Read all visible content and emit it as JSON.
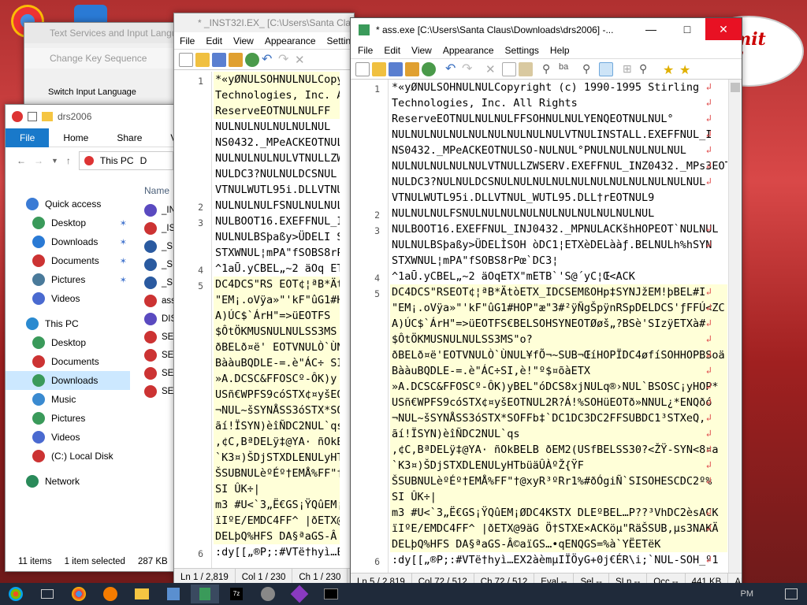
{
  "desktop": {
    "greeting_fragment": "mit\nv"
  },
  "text_services_window": {
    "title": "Text Services and Input Langua",
    "sub_title": "Change Key Sequence",
    "body_label": "Switch Input Language"
  },
  "explorer": {
    "title": "drs2006",
    "ribbon_tabs": [
      "File",
      "Home",
      "Share",
      "View"
    ],
    "breadcrumb_root": "This PC",
    "breadcrumb_next": "D",
    "column_header": "Name",
    "nav": [
      {
        "label": "Quick access",
        "level": 0
      },
      {
        "label": "Desktop",
        "level": 1,
        "pinned": true
      },
      {
        "label": "Downloads",
        "level": 1,
        "pinned": true
      },
      {
        "label": "Documents",
        "level": 1,
        "pinned": true
      },
      {
        "label": "Pictures",
        "level": 1,
        "pinned": true
      },
      {
        "label": "Videos",
        "level": 1,
        "pinned": false
      },
      {
        "label": "This PC",
        "level": 0
      },
      {
        "label": "Desktop",
        "level": 1
      },
      {
        "label": "Documents",
        "level": 1
      },
      {
        "label": "Downloads",
        "level": 1,
        "selected": true
      },
      {
        "label": "Music",
        "level": 1
      },
      {
        "label": "Pictures",
        "level": 1
      },
      {
        "label": "Videos",
        "level": 1
      },
      {
        "label": "(C:) Local Disk",
        "level": 1
      },
      {
        "label": "Network",
        "level": 0
      }
    ],
    "files": [
      "_IN",
      "_IS",
      "_SE",
      "_SE",
      "_SE",
      "ass",
      "DIS",
      "SET",
      "SET",
      "SET",
      "SET"
    ],
    "status_items": "11 items",
    "status_selected": "1 item selected",
    "status_size": "287 KB"
  },
  "notepad_back": {
    "title": "* _INST32I.EX_ [C:\\Users\\Santa Claus\\",
    "menu": [
      "File",
      "Edit",
      "View",
      "Appearance",
      "Settin"
    ],
    "lines": [
      {
        "n": "1",
        "t": "*«yØNULSOHNULNULCopyr",
        "hl": true
      },
      {
        "n": "",
        "t": "Technologies, Inc. All",
        "hl": true
      },
      {
        "n": "",
        "t": "ReserveEOTNULNULFF",
        "hl": true
      },
      {
        "n": "",
        "t": "NULNULNULNULNULNUL",
        "hl": false
      },
      {
        "n": "",
        "t": "NS0432._MPeACKEOTNUL",
        "hl": false
      },
      {
        "n": "",
        "t": "NULNULNULNULVTNULLZWS",
        "hl": false
      },
      {
        "n": "",
        "t": "NULDC3?NULNULDCSNUL",
        "hl": false
      },
      {
        "n": "",
        "t": "VTNULWUTL95i.DLLVTNUL",
        "hl": false
      },
      {
        "n": "2",
        "t": "NULNULNULFSNULNULNUL",
        "hl": false
      },
      {
        "n": "3",
        "t": "NULBOOT16.EXEFFNUL_IN",
        "hl": false
      },
      {
        "n": "",
        "t": "NULNULBSþaßy>ÜDELI SOH",
        "hl": false
      },
      {
        "n": "",
        "t": "STXWNUL¦mPA\"fSOBS8rP",
        "hl": false
      },
      {
        "n": "4",
        "t": "^1aŪ.yCBEL„~2 äOq ETX",
        "hl": false
      },
      {
        "n": "5",
        "t": "DC4DCS\"RS EOT¢¦ªB*Ätt",
        "hl": true
      },
      {
        "n": "",
        "t": "\"EM¡.oVÿa»\"'kF\"ûG1#HOP",
        "hl": true
      },
      {
        "n": "",
        "t": "A)ÚC$`ÁrH\"=>üEOTFS",
        "hl": true
      },
      {
        "n": "",
        "t": "$ÔtÖKMUSNULNULSS3MS",
        "hl": true
      },
      {
        "n": "",
        "t": "ðBELð¤ë' EOTVNULÒ`ÙNUL",
        "hl": true
      },
      {
        "n": "",
        "t": "BààuBQDLE-=.è\"ÁC÷ SI,è",
        "hl": true
      },
      {
        "n": "",
        "t": "»A.DCSC&FFOSCº-ÔK)y",
        "hl": true
      },
      {
        "n": "",
        "t": "USñ€WPFS9cóSTX¢¤yšEO",
        "hl": true
      },
      {
        "n": "",
        "t": "¬NUL~šSYNÅSS3óSTX*SO",
        "hl": true
      },
      {
        "n": "",
        "t": "ãí!ÏSYN)èîÑDC2NUL`qs",
        "hl": true
      },
      {
        "n": "",
        "t": ",¢C,BªDELÿ‡@YA· ñOkBE",
        "hl": true
      },
      {
        "n": "",
        "t": "`K3¤)ŠDjSTXDLENULyHTb",
        "hl": true
      },
      {
        "n": "",
        "t": "ŠSUBNULèºÉº†EMÅ%FF\"†@",
        "hl": true
      },
      {
        "n": "",
        "t": "SI ÛK÷|",
        "hl": true
      },
      {
        "n": "",
        "t": "m3  #U<`3„Ë€GS¡ŸQûEM¡",
        "hl": true
      },
      {
        "n": "",
        "t": "ïIºE/EMDC4FF^ |ðETX@",
        "hl": true
      },
      {
        "n": "",
        "t": "DELþQ%HFS DA§ªaGS-Â",
        "hl": true
      },
      {
        "n": "6",
        "t": ":dy[[„®P;:#VTë†hyì…EX",
        "hl": false
      }
    ],
    "status": [
      "Ln 1 / 2,819",
      "Col 1 / 230",
      "Ch 1 / 230",
      "Ev"
    ]
  },
  "notepad_front": {
    "title": "* ass.exe [C:\\Users\\Santa Claus\\Downloads\\drs2006] -...",
    "menu": [
      "File",
      "Edit",
      "View",
      "Appearance",
      "Settings",
      "Help"
    ],
    "lines": [
      {
        "n": "1",
        "t": "*«yØNULSOHNULNULCopyright (c) 1990-1995 Stirling",
        "hl": false,
        "wrap": true
      },
      {
        "n": "",
        "t": "Technologies, Inc. All Rights",
        "hl": false,
        "wrap": true
      },
      {
        "n": "",
        "t": "ReserveEOTNULNULNULFFSOHNULNULYENQEOTNULNUL°",
        "hl": false,
        "wrap": true
      },
      {
        "n": "",
        "t": "NULNULNULNULNULNULNULNULNULVTNULINSTALL.EXEFFNUL_I",
        "hl": false,
        "wrap": true
      },
      {
        "n": "",
        "t": "NS0432._MPeACKEOTNULSO-NULNUL°PNULNULNULNULNUL",
        "hl": false,
        "wrap": true
      },
      {
        "n": "",
        "t": "NULNULNULNULNULVTNULLZWSERV.EXEFFNUL_INZ0432._MPs3EOT",
        "hl": false,
        "wrap": true
      },
      {
        "n": "",
        "t": "NULDC3?NULNULDCSNULNULNULNULNULNULNULNULNULNULNUL",
        "hl": false,
        "wrap": true
      },
      {
        "n": "",
        "t": "VTNULWUTL95i.DLLVTNUL_WUTL95.DLL†rEOTNUL9",
        "hl": false,
        "wrap": false
      },
      {
        "n": "2",
        "t": "NULNULNULFSNULNULNULNULNULNULNULNULNULNUL",
        "hl": false,
        "wrap": false
      },
      {
        "n": "3",
        "t": "NULBOOT16.EXEFFNUL_INJ0432._MPNULACKšhHOPEOT`NULNUL",
        "hl": false,
        "wrap": true
      },
      {
        "n": "",
        "t": "NULNULBSþaßy>ÜDELÌSOH òDC1¦ETXèDELààƒ.BELNULh%hSYN",
        "hl": false,
        "wrap": true
      },
      {
        "n": "",
        "t": "STXWNUL¦mPA\"fSOBS8rPœ`DC3¦",
        "hl": false,
        "wrap": false
      },
      {
        "n": "4",
        "t": "^1aŪ.yCBEL„~2 äOqETX\"mETB`'S@´yC¦Œ<ACK",
        "hl": false,
        "wrap": false
      },
      {
        "n": "5",
        "t": "DC4DCS\"RSEOT¢¦ªB*ÄtòETX_IDCSEMßOHp‡SYNJžEM!þBEL#I",
        "hl": true,
        "wrap": true
      },
      {
        "n": "",
        "t": "\"EM¡.oVÿa»\"'kF\"ûG1#HOP\"æ\"3#²ÿÑgŠpÿnRSpDELDCS'ƒFFÚ<ZC",
        "hl": true,
        "wrap": true
      },
      {
        "n": "",
        "t": "A)ÚC$`ÁrH\"=>üEOTFS€BELSOHSYNEOTØøš„?BSè'SIzÿETXà#",
        "hl": true,
        "wrap": true
      },
      {
        "n": "",
        "t": "$ÔtÖKMUSNULNULSS3MS\"o?",
        "hl": true,
        "wrap": true
      },
      {
        "n": "",
        "t": "ðBELð¤ë'EOTVNULÒ`ÙNUL¥fÕ¬~SUB¬ŒíHOPÏDC4øfíSOHHOPBSoä",
        "hl": true,
        "wrap": true
      },
      {
        "n": "",
        "t": "BààuBQDLE-=.è\"ÁC÷SI,è!\"º$¤õàETX",
        "hl": true,
        "wrap": true
      },
      {
        "n": "",
        "t": "»A.DCSC&FFOSCº-ÔK)yBEL\"óDCS8xjNULq®›NUL`BSOSC¡yHOP*",
        "hl": true,
        "wrap": true
      },
      {
        "n": "",
        "t": "USñ€WPFS9cóSTX¢¤yšEOTNUL2R?Á!%SOHüEOTð»NNUL¿*ENQðó",
        "hl": true,
        "wrap": true
      },
      {
        "n": "",
        "t": "¬NUL~šSYNÅSS3óSTX*SOFFb‡`DC1DC3DC2FFSUBDC1³STXeQ,",
        "hl": true,
        "wrap": true
      },
      {
        "n": "",
        "t": "ãí!ÏSYN)èîÑDC2NUL`qs",
        "hl": true,
        "wrap": true
      },
      {
        "n": "",
        "t": ",¢C,BªDELÿ‡@YA· ñOkBELB ðEM2(USfBELSS30?<ŽŸ-SYN<8¤a",
        "hl": true,
        "wrap": true
      },
      {
        "n": "",
        "t": "`K3¤)ŠDjSTXDLENULyHTbüäÛÀºŽ{ŸF",
        "hl": true,
        "wrap": true
      },
      {
        "n": "",
        "t": "ŠSUBNULèºÉº†EMÅ%FF\"†@xyR³ºRr1%#ðÓgiÑ`SISOHESCDC2º%",
        "hl": true,
        "wrap": true
      },
      {
        "n": "",
        "t": "SI ÛK÷|",
        "hl": true,
        "wrap": false
      },
      {
        "n": "",
        "t": "m3  #U<`3„Ë€GS¡ŸQûEM¡ØDC4KSTX DLEºBEL…P??³VhDC2èsACK",
        "hl": true,
        "wrap": true
      },
      {
        "n": "",
        "t": "ïIºE/EMDC4FF^ |ðETX@9äG Ö†STXE×ACKöµ\"RäŠSUB,µs3NAKÄ",
        "hl": true,
        "wrap": true
      },
      {
        "n": "",
        "t": "DELþQ%HFS DA§ªaGS-Â©aïGS…•qENQGS=%à`YËETëK",
        "hl": true,
        "wrap": false
      },
      {
        "n": "6",
        "t": ":dy[[„®P;:#VTë†hyì…EX2àèmµIÏÖyG+0j€ÉR\\i;`NUL-SOH_º1",
        "hl": false,
        "wrap": true
      }
    ],
    "status": [
      "Ln 5 / 2,819",
      "Col 72 / 512",
      "Ch 72 / 512",
      "Eval --",
      "Sel --",
      "SLn --",
      "Occ --",
      "441 KB",
      "ANSI (CP-1"
    ]
  },
  "taskbar": {
    "clock": "PM"
  }
}
